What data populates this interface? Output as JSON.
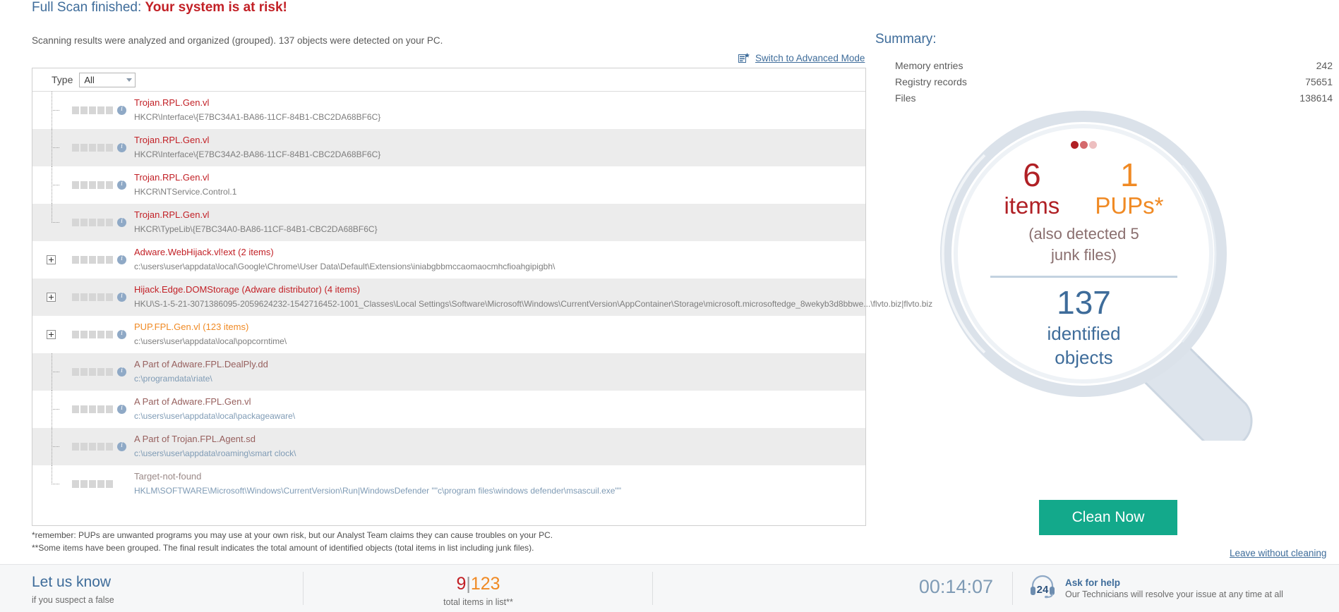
{
  "header": {
    "scan_status": "Full Scan finished: ",
    "risk_text": "Your system is at risk!",
    "subtitle": "Scanning results were analyzed and organized (grouped). 137 objects were detected on your PC."
  },
  "advanced_mode": {
    "label": "Switch to Advanced Mode"
  },
  "filter": {
    "type_label": "Type",
    "selected": "All"
  },
  "threats": [
    {
      "name": "Trojan.RPL.Gen.vl",
      "path": "HKCR\\Interface\\{E7BC34A1-BA86-11CF-84B1-CBC2DA68BF6C}",
      "severity": 5,
      "sev_color": "c-red",
      "name_color": "t-red",
      "path_color": "",
      "expandable": false,
      "tree": "stub"
    },
    {
      "name": "Trojan.RPL.Gen.vl",
      "path": "HKCR\\Interface\\{E7BC34A2-BA86-11CF-84B1-CBC2DA68BF6C}",
      "severity": 5,
      "sev_color": "c-red",
      "name_color": "t-red",
      "path_color": "",
      "expandable": false,
      "tree": "stub"
    },
    {
      "name": "Trojan.RPL.Gen.vl",
      "path": "HKCR\\NTService.Control.1",
      "severity": 5,
      "sev_color": "c-red",
      "name_color": "t-red",
      "path_color": "",
      "expandable": false,
      "tree": "stub"
    },
    {
      "name": "Trojan.RPL.Gen.vl",
      "path": "HKCR\\TypeLib\\{E7BC34A0-BA86-11CF-84B1-CBC2DA68BF6C}",
      "severity": 5,
      "sev_color": "c-red",
      "name_color": "t-red",
      "path_color": "",
      "expandable": false,
      "tree": "stub-end"
    },
    {
      "name": "Adware.WebHijack.vl!ext (2 items)",
      "path": "c:\\users\\user\\appdata\\local\\Google\\Chrome\\User Data\\Default\\Extensions\\iniabgbbmccaomaocmhcfioahgipigbh\\",
      "severity": 2,
      "sev_color": "c-red",
      "name_color": "t-red",
      "path_color": "",
      "expandable": true,
      "tree": "none"
    },
    {
      "name": "Hijack.Edge.DOMStorage (Adware distributor) (4 items)",
      "path": "HKU\\S-1-5-21-3071386095-2059624232-1542716452-1001_Classes\\Local Settings\\Software\\Microsoft\\Windows\\CurrentVersion\\AppContainer\\Storage\\microsoft.microsoftedge_8wekyb3d8bbwe...\\flvto.biz|flvto.biz",
      "severity": 1,
      "sev_color": "c-red",
      "name_color": "t-red",
      "path_color": "",
      "expandable": true,
      "tree": "none"
    },
    {
      "name": "PUP.FPL.Gen.vl (123 items)",
      "path": "c:\\users\\user\\appdata\\local\\popcorntime\\",
      "severity": 3,
      "sev_color": "c-orange",
      "name_color": "t-orange",
      "path_color": "",
      "expandable": true,
      "tree": "none"
    },
    {
      "name": "A Part of Adware.FPL.DealPly.dd",
      "path": "c:\\programdata\\riate\\",
      "severity": 1,
      "sev_color": "c-brown",
      "name_color": "t-brown",
      "path_color": "p-blue",
      "expandable": false,
      "tree": "stub"
    },
    {
      "name": "A Part of Adware.FPL.Gen.vl",
      "path": "c:\\users\\user\\appdata\\local\\packageaware\\",
      "severity": 1,
      "sev_color": "c-brown",
      "name_color": "t-brown",
      "path_color": "p-blue",
      "expandable": false,
      "tree": "stub"
    },
    {
      "name": "A Part of Trojan.FPL.Agent.sd",
      "path": "c:\\users\\user\\appdata\\roaming\\smart clock\\",
      "severity": 1,
      "sev_color": "c-brown",
      "name_color": "t-brown",
      "path_color": "p-blue",
      "expandable": false,
      "tree": "stub"
    },
    {
      "name": "Target-not-found",
      "path": "HKLM\\SOFTWARE\\Microsoft\\Windows\\CurrentVersion\\Run|WindowsDefender \"\"c\\program files\\windows defender\\msascuil.exe\"\"",
      "severity": 0,
      "sev_color": "c-grey",
      "name_color": "t-grey",
      "path_color": "p-blue",
      "expandable": false,
      "tree": "stub-end"
    }
  ],
  "footnotes": {
    "line1": "*remember: PUPs are unwanted programs you may use at your own risk, but our Analyst Team claims they can cause troubles on your PC.",
    "line2": "**Some items have been grouped. The final result indicates the total amount of identified objects (total items in list including junk files)."
  },
  "summary": {
    "title": "Summary:",
    "rows": [
      {
        "label": "Memory entries",
        "value": "242"
      },
      {
        "label": "Registry records",
        "value": "75651"
      },
      {
        "label": "Files",
        "value": "138614"
      }
    ]
  },
  "lens": {
    "items_count": "6",
    "items_label": "items",
    "pups_count": "1",
    "pups_label": "PUPs*",
    "junk_line1": "(also detected 5",
    "junk_line2": "junk files)",
    "total_count": "137",
    "total_label1": "identified",
    "total_label2": "objects"
  },
  "actions": {
    "clean_button": "Clean Now",
    "leave_link": "Leave without cleaning"
  },
  "bottom": {
    "let_us_know_title": "Let us know",
    "let_us_know_sub": "if you suspect a false",
    "total_a": "9",
    "total_sep": "|",
    "total_b": "123",
    "total_caption": "total items in list**",
    "timer": "00:14:07",
    "help_badge": "24",
    "help_title": "Ask for help",
    "help_sub": "Our Technicians will resolve your issue at any time at all"
  },
  "colors": {
    "accent_blue": "#3e6c9a",
    "danger_red": "#c22026",
    "pup_orange": "#f08a24",
    "clean_green": "#13a98b"
  }
}
